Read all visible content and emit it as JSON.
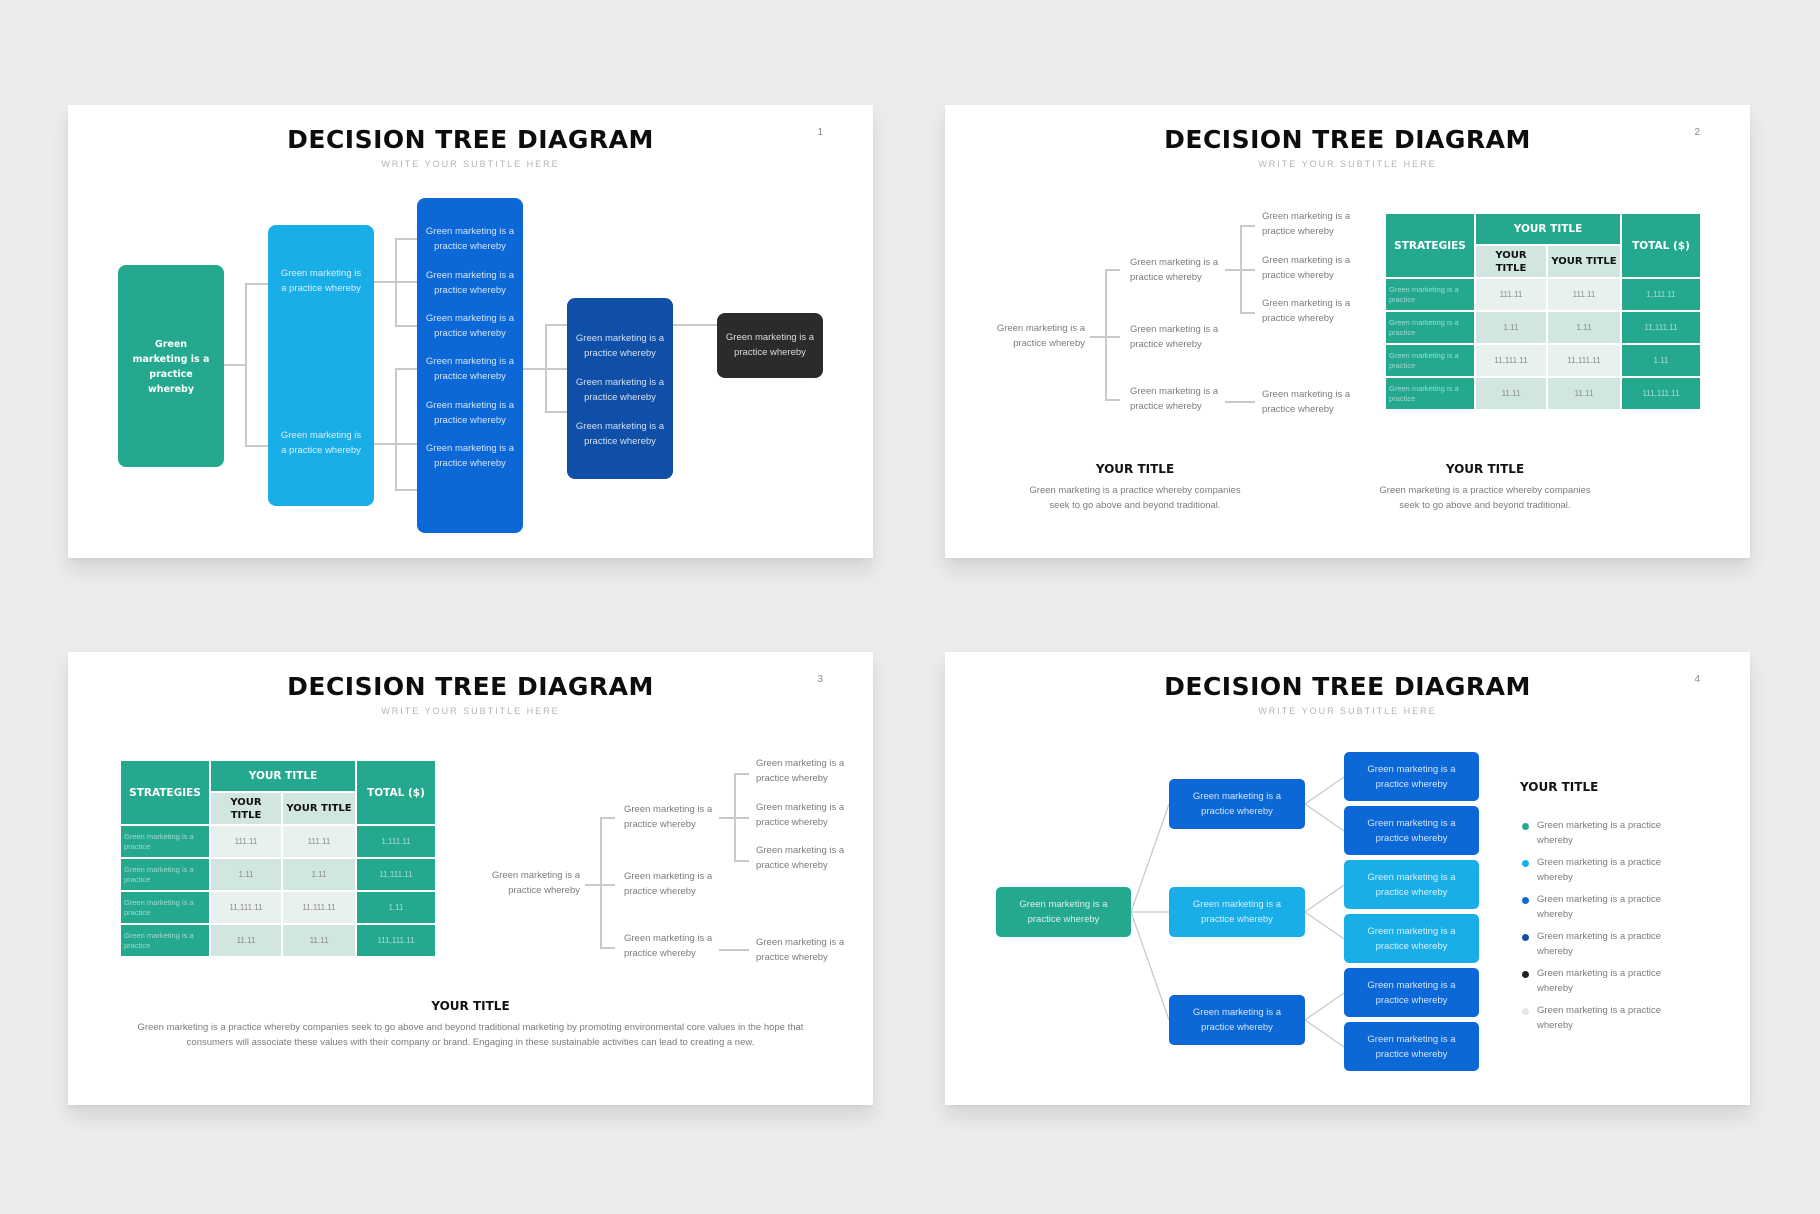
{
  "colors": {
    "green": "#25a98e",
    "light_blue": "#1aaee8",
    "blue": "#0c68d6",
    "navy": "#0f4fa8",
    "dark": "#2b2b2b",
    "light_gray": "#e6e6e6",
    "connector": "#c9c9c9"
  },
  "slides": [
    {
      "page": "1",
      "title": "DECISION TREE DIAGRAM",
      "subtitle": "WRITE YOUR SUBTITLE HERE",
      "root": "Green marketing is a practice whereby",
      "level1": [
        "Green marketing is a practice whereby",
        "Green marketing is a practice whereby"
      ],
      "level2": [
        "Green marketing is a practice whereby",
        "Green marketing is a practice whereby",
        "Green marketing is a practice whereby",
        "Green marketing is a practice whereby",
        "Green marketing is a practice whereby",
        "Green marketing is a practice whereby"
      ],
      "level3": [
        "Green marketing is a practice whereby",
        "Green marketing is a practice whereby",
        "Green marketing is a practice whereby"
      ],
      "level4": "Green marketing is a practice whereby"
    },
    {
      "page": "2",
      "title": "DECISION TREE DIAGRAM",
      "subtitle": "WRITE YOUR SUBTITLE HERE",
      "tree": {
        "root": "Green marketing is a practice whereby",
        "middle": [
          "Green marketing is a practice whereby",
          "Green marketing is a practice whereby",
          "Green marketing is a practice whereby"
        ],
        "leaves": [
          "Green marketing is a practice whereby",
          "Green marketing is a practice whereby",
          "Green marketing is a practice whereby",
          "Green marketing is a practice whereby"
        ]
      },
      "table": {
        "header_strategies": "STRATEGIES",
        "header_group": "YOUR TITLE",
        "header_sub1": "YOUR TITLE",
        "header_sub2": "YOUR TITLE",
        "header_total": "TOTAL ($)",
        "rows": [
          {
            "label": "Green marketing is a practice",
            "a": "111.11",
            "b": "111.11",
            "total": "1,111.11"
          },
          {
            "label": "Green marketing is a practice",
            "a": "1.11",
            "b": "1.11",
            "total": "11,111.11"
          },
          {
            "label": "Green marketing is a practice",
            "a": "11,111.11",
            "b": "11,111.11",
            "total": "1.11"
          },
          {
            "label": "Green marketing is a practice",
            "a": "11.11",
            "b": "11.11",
            "total": "111,111.11"
          }
        ]
      },
      "sections": [
        {
          "title": "YOUR TITLE",
          "body": "Green marketing is a practice whereby companies seek to go above and beyond traditional."
        },
        {
          "title": "YOUR TITLE",
          "body": "Green marketing is a practice whereby companies seek to go above and beyond traditional."
        }
      ]
    },
    {
      "page": "3",
      "title": "DECISION TREE DIAGRAM",
      "subtitle": "WRITE YOUR SUBTITLE HERE",
      "table": {
        "header_strategies": "STRATEGIES",
        "header_group": "YOUR TITLE",
        "header_sub1": "YOUR TITLE",
        "header_sub2": "YOUR TITLE",
        "header_total": "TOTAL ($)",
        "rows": [
          {
            "label": "Green marketing is a practice",
            "a": "111.11",
            "b": "111.11",
            "total": "1,111.11"
          },
          {
            "label": "Green marketing is a practice",
            "a": "1.11",
            "b": "1.11",
            "total": "11,111.11"
          },
          {
            "label": "Green marketing is a practice",
            "a": "11,111.11",
            "b": "11,111.11",
            "total": "1.11"
          },
          {
            "label": "Green marketing is a practice",
            "a": "11.11",
            "b": "11.11",
            "total": "111,111.11"
          }
        ]
      },
      "tree": {
        "root": "Green marketing is a practice whereby",
        "middle": [
          "Green marketing is a practice whereby",
          "Green marketing is a practice whereby",
          "Green marketing is a practice whereby"
        ],
        "leaves": [
          "Green marketing is a practice whereby",
          "Green marketing is a practice whereby",
          "Green marketing is a practice whereby",
          "Green marketing is a practice whereby"
        ]
      },
      "section": {
        "title": "YOUR TITLE",
        "body": "Green marketing is a practice whereby companies seek to go above and beyond traditional marketing by promoting environmental core values in the hope that consumers will associate these values with their company or brand. Engaging in these sustainable activities can lead to creating a new."
      }
    },
    {
      "page": "4",
      "title": "DECISION TREE DIAGRAM",
      "subtitle": "WRITE YOUR SUBTITLE HERE",
      "root": "Green marketing is a practice whereby",
      "middle": [
        "Green marketing is a practice whereby",
        "Green marketing is a practice whereby",
        "Green marketing is a practice whereby"
      ],
      "leaves": [
        "Green marketing is a practice whereby",
        "Green marketing is a practice whereby",
        "Green marketing is a practice whereby",
        "Green marketing is a practice whereby",
        "Green marketing is a practice whereby",
        "Green marketing is a practice whereby"
      ],
      "legend_title": "YOUR TITLE",
      "legend": [
        {
          "color": "#25a98e",
          "text": "Green marketing is a practice whereby"
        },
        {
          "color": "#1aaee8",
          "text": "Green marketing is a practice whereby"
        },
        {
          "color": "#0c68d6",
          "text": "Green marketing is a practice whereby"
        },
        {
          "color": "#0f4fa8",
          "text": "Green marketing is a practice whereby"
        },
        {
          "color": "#1f1f1f",
          "text": "Green marketing is a practice whereby"
        },
        {
          "color": "#e6e6e6",
          "text": "Green marketing is a practice whereby"
        }
      ]
    }
  ]
}
